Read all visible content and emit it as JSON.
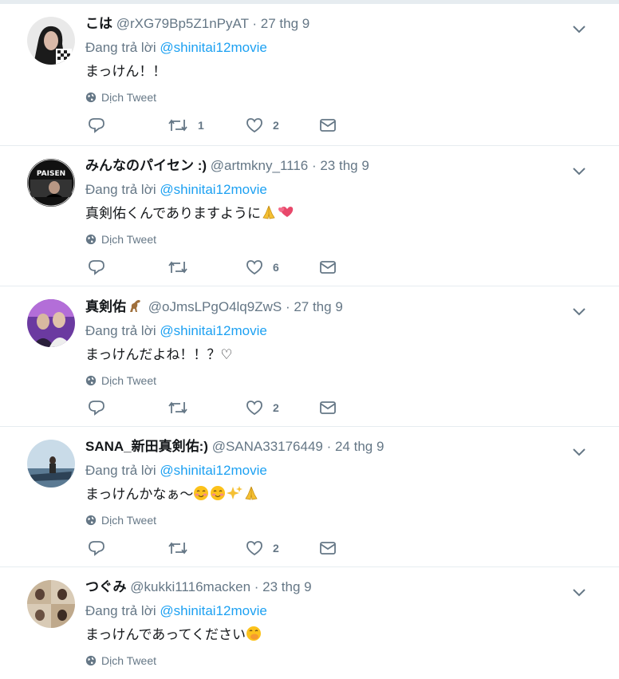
{
  "ui": {
    "reply_prefix": "Đang trả lời",
    "translate_label": "Dịch Tweet"
  },
  "tweets": [
    {
      "name": "こは",
      "handle_date": "@rXG79Bp5Z1nPyAT · 27 thg 9",
      "reply_to": "@shinitai12movie",
      "text": "まっけん！！",
      "retweets": "1",
      "likes": "2"
    },
    {
      "name": "みんなのパイセン :)",
      "handle_date": "@artmkny_1116 · 23 thg 9",
      "reply_to": "@shinitai12movie",
      "text": "真剣佑くんでありますように",
      "retweets": "",
      "likes": "6",
      "avatar_text": "PAISEN"
    },
    {
      "name": "真剣佑",
      "handle_date": "@oJmsLPgO4lq9ZwS · 27 thg 9",
      "reply_to": "@shinitai12movie",
      "text": "まっけんだよね！！？♡",
      "retweets": "",
      "likes": "2"
    },
    {
      "name": "SANA_新田真剣佑:)",
      "handle_date": "@SANA33176449 · 24 thg 9",
      "reply_to": "@shinitai12movie",
      "text": "まっけんかなぁ〜",
      "retweets": "",
      "likes": "2"
    },
    {
      "name": "つぐみ",
      "handle_date": "@kukki1116macken · 23 thg 9",
      "reply_to": "@shinitai12movie",
      "text": "まっけんであってください",
      "retweets": "",
      "likes": ""
    }
  ],
  "colors": {
    "accent": "#1da1f2",
    "secondary_text": "#657786",
    "border": "#e6ecf0"
  },
  "icons": [
    "reply-icon",
    "retweet-icon",
    "like-icon",
    "message-icon",
    "globe-icon",
    "chevron-down-icon"
  ]
}
